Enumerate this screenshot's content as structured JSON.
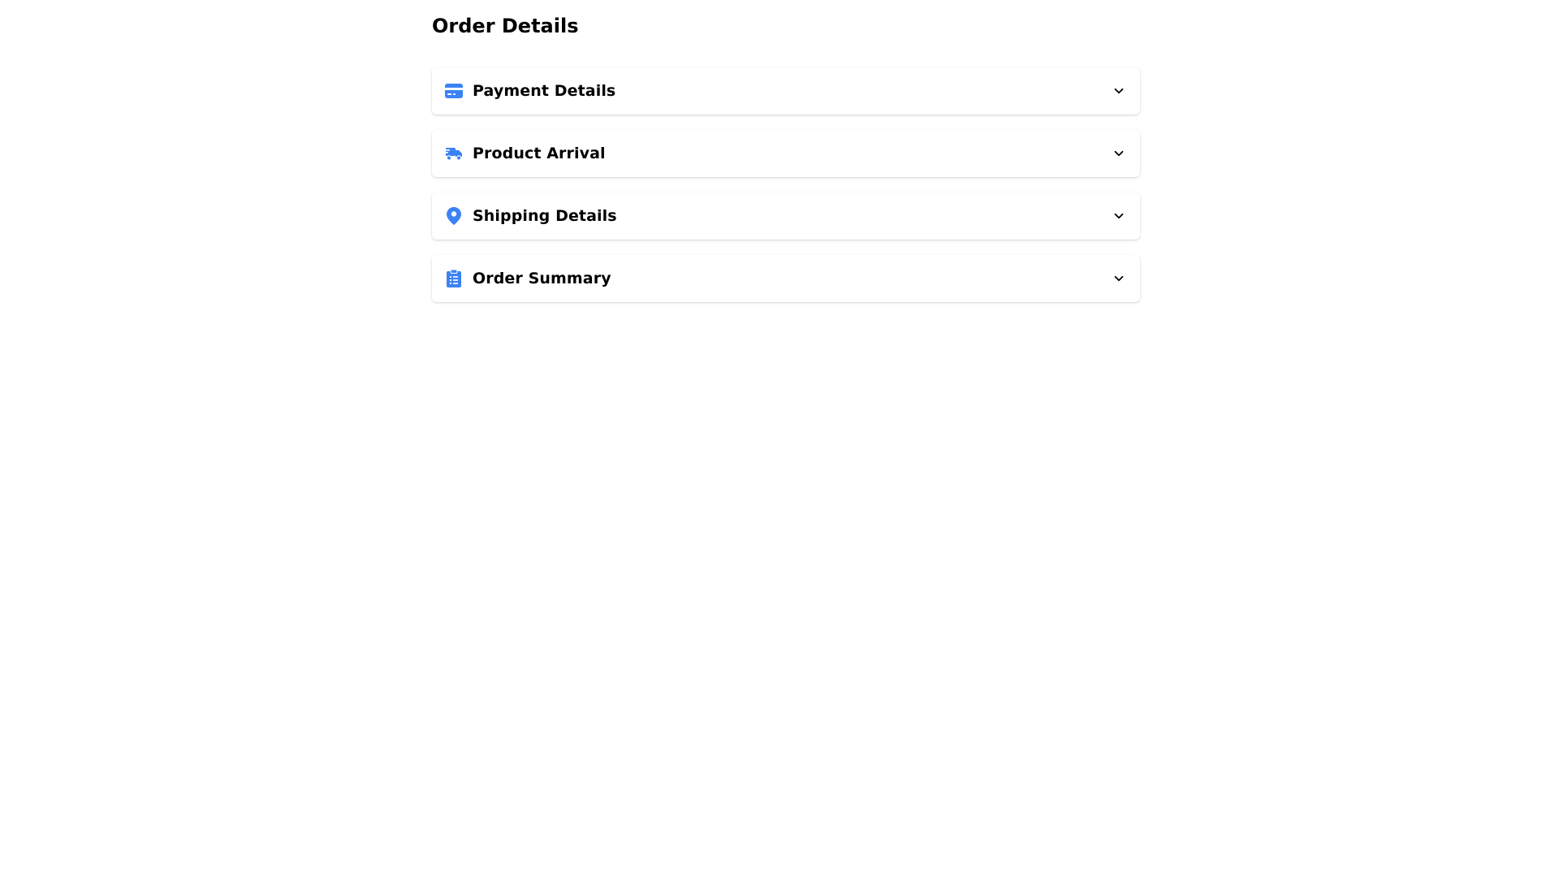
{
  "page": {
    "title": "Order Details"
  },
  "theme": {
    "accent": "#3b82f6",
    "text": "#000000",
    "card_bg": "#ffffff"
  },
  "sections": [
    {
      "label": "Payment Details",
      "icon": "credit-card-icon",
      "expanded": false
    },
    {
      "label": "Product Arrival",
      "icon": "truck-icon",
      "expanded": false
    },
    {
      "label": "Shipping Details",
      "icon": "map-pin-icon",
      "expanded": false
    },
    {
      "label": "Order Summary",
      "icon": "clipboard-list-icon",
      "expanded": false
    }
  ]
}
